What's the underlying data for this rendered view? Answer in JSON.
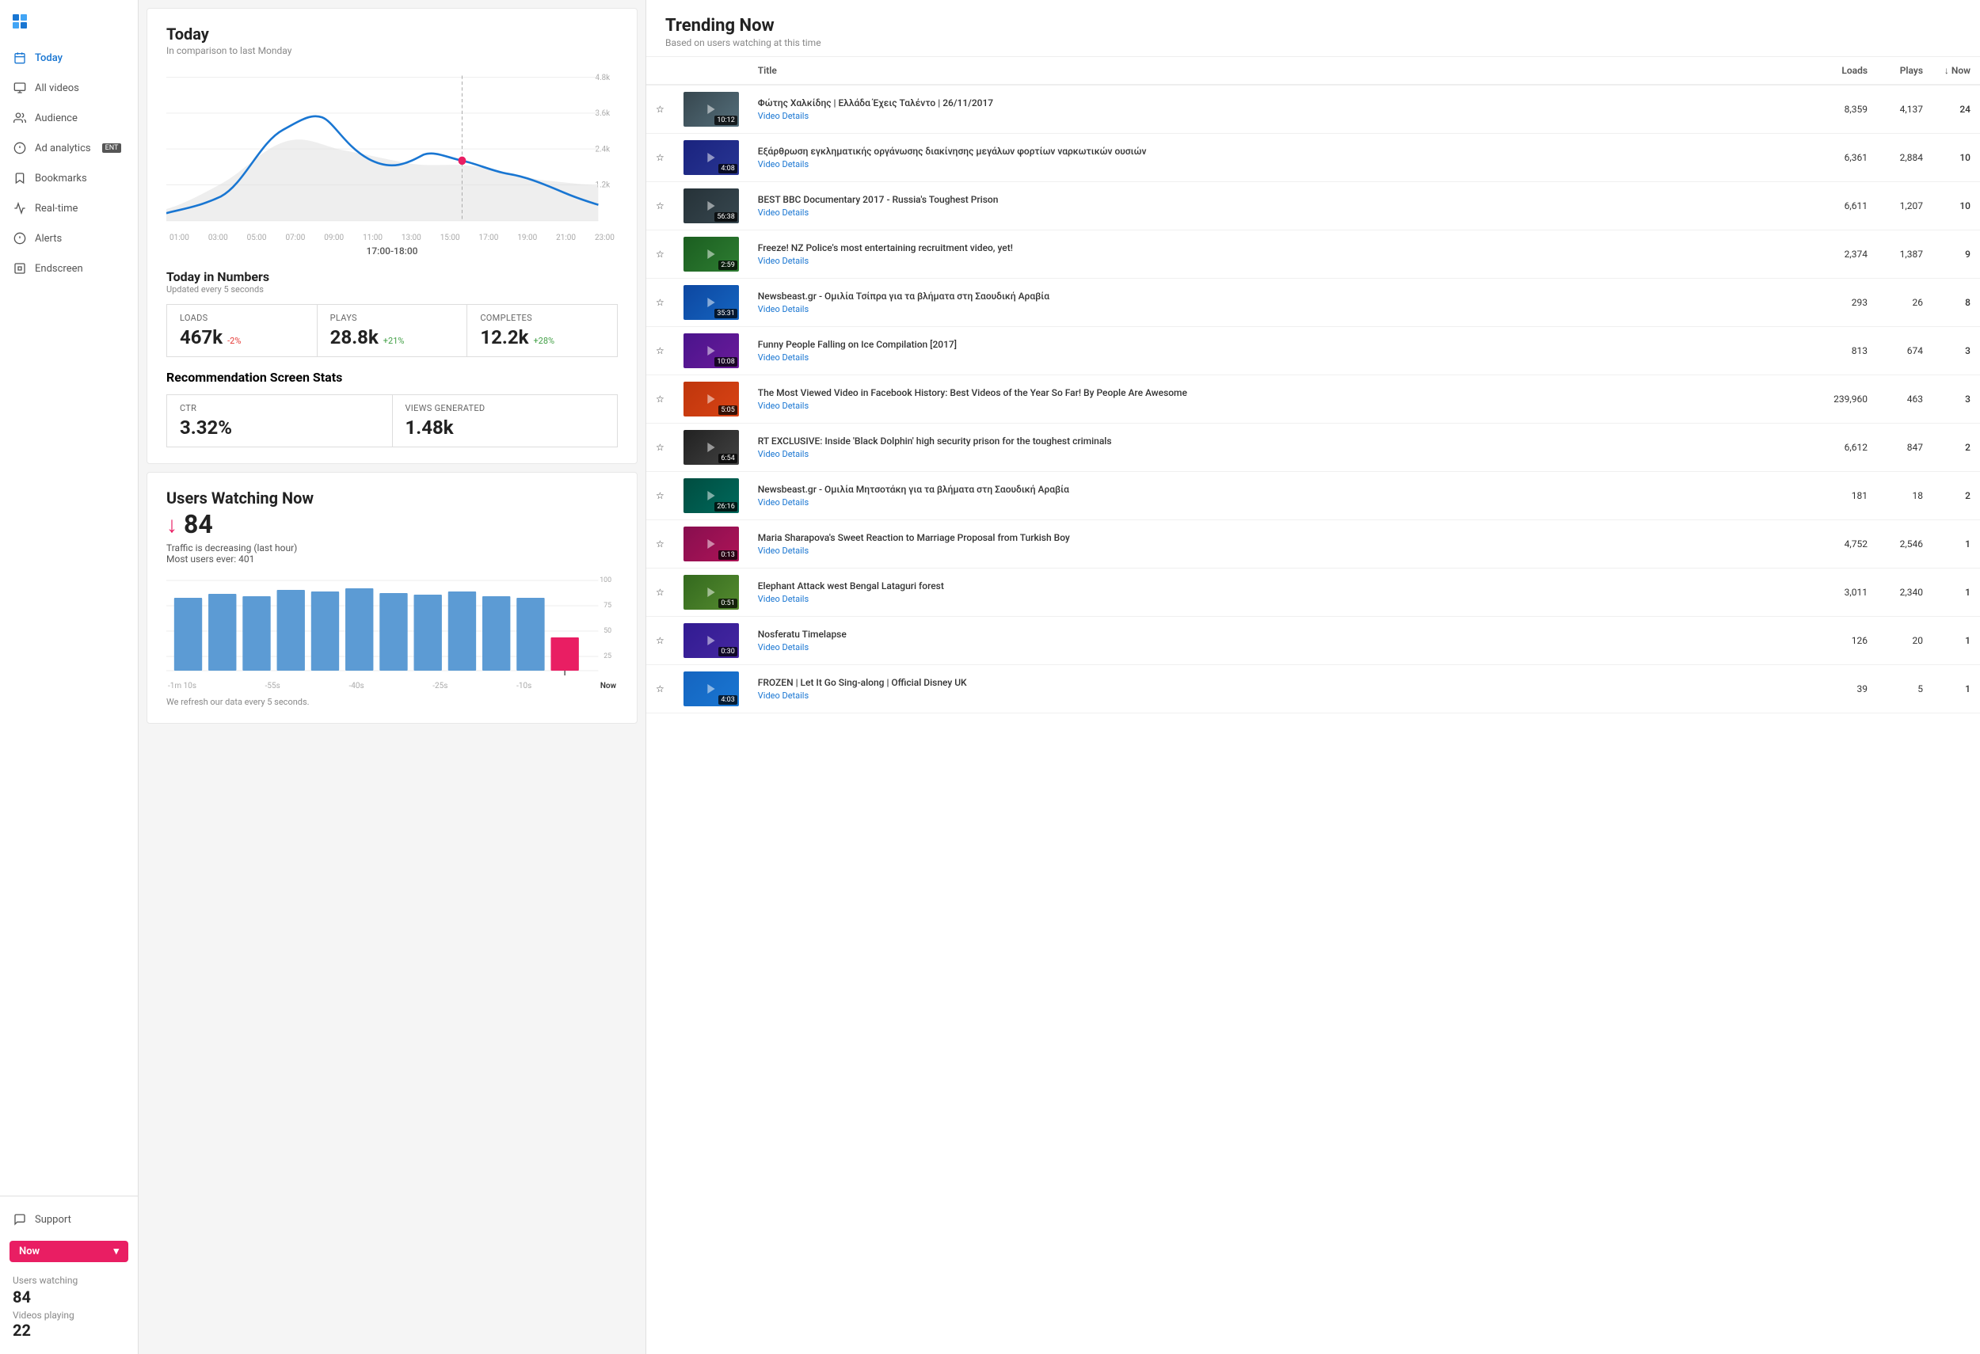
{
  "sidebar": {
    "nav_items": [
      {
        "id": "today",
        "label": "Today",
        "active": true
      },
      {
        "id": "all-videos",
        "label": "All videos",
        "active": false
      },
      {
        "id": "audience",
        "label": "Audience",
        "active": false
      },
      {
        "id": "ad-analytics",
        "label": "Ad analytics",
        "badge": "ENT",
        "active": false
      },
      {
        "id": "bookmarks",
        "label": "Bookmarks",
        "active": false
      },
      {
        "id": "real-time",
        "label": "Real-time",
        "active": false
      },
      {
        "id": "alerts",
        "label": "Alerts",
        "active": false
      },
      {
        "id": "endscreen",
        "label": "Endscreen",
        "active": false
      }
    ],
    "bottom": {
      "support_label": "Support",
      "now_button": "Now",
      "users_watching_label": "Users watching",
      "users_watching_value": "84",
      "videos_playing_label": "Videos playing",
      "videos_playing_value": "22"
    }
  },
  "today_panel": {
    "title": "Today",
    "subtitle": "In comparison to last Monday",
    "chart": {
      "y_labels": [
        "4.8k",
        "3.6k",
        "2.4k",
        "1.2k"
      ],
      "x_labels": [
        "01:00",
        "03:00",
        "05:00",
        "07:00",
        "09:00",
        "11:00",
        "13:00",
        "15:00",
        "17:00",
        "19:00",
        "21:00",
        "23:00"
      ],
      "time_label": "17:00-18:00"
    },
    "numbers": {
      "title": "Today in Numbers",
      "subtitle": "Updated every 5 seconds",
      "loads": {
        "label": "Loads",
        "value": "467k",
        "change": "-2%",
        "change_type": "neg"
      },
      "plays": {
        "label": "Plays",
        "value": "28.8k",
        "change": "+21%",
        "change_type": "pos"
      },
      "completes": {
        "label": "Completes",
        "value": "12.2k",
        "change": "+28%",
        "change_type": "pos"
      }
    },
    "recommendation": {
      "title": "Recommendation Screen Stats",
      "ctr": {
        "label": "CTR",
        "value": "3.32%"
      },
      "views_generated": {
        "label": "Views Generated",
        "value": "1.48k"
      }
    }
  },
  "watching_now_panel": {
    "title": "Users Watching Now",
    "count": "84",
    "traffic_note": "Traffic is decreasing (last hour)",
    "max_note": "Most users ever: 401",
    "bar_labels": [
      "-1m 10s",
      "-55s",
      "-40s",
      "-25s",
      "-10s",
      "Now"
    ],
    "y_labels": [
      "100",
      "75",
      "50",
      "25"
    ],
    "refresh_note": "We refresh our data every 5 seconds."
  },
  "trending": {
    "title": "Trending Now",
    "subtitle": "Based on users watching at this time",
    "col_title": "Title",
    "col_loads": "Loads",
    "col_plays": "Plays",
    "col_now": "↓ Now",
    "videos": [
      {
        "id": 1,
        "duration": "10:12",
        "title": "Φώτης Χαλκίδης | Ελλάδα Έχεις Ταλέντο | 26/11/2017",
        "details_link": "Video Details",
        "loads": "8,359",
        "plays": "4,137",
        "now": "24",
        "thumb_class": "t1"
      },
      {
        "id": 2,
        "duration": "4:08",
        "title": "Εξάρθρωση εγκληματικής οργάνωσης διακίνησης μεγάλων φορτίων ναρκωτικών ουσιών",
        "details_link": "Video Details",
        "loads": "6,361",
        "plays": "2,884",
        "now": "10",
        "thumb_class": "t2"
      },
      {
        "id": 3,
        "duration": "56:38",
        "title": "BEST BBC Documentary 2017 - Russia's Toughest Prison",
        "details_link": "Video Details",
        "loads": "6,611",
        "plays": "1,207",
        "now": "10",
        "thumb_class": "t3"
      },
      {
        "id": 4,
        "duration": "2:59",
        "title": "Freeze! NZ Police's most entertaining recruitment video, yet!",
        "details_link": "Video Details",
        "loads": "2,374",
        "plays": "1,387",
        "now": "9",
        "thumb_class": "t4"
      },
      {
        "id": 5,
        "duration": "35:31",
        "title": "Newsbeast.gr - Ομιλία Τσίπρα για τα βλήματα στη Σαουδική Αραβία",
        "details_link": "Video Details",
        "loads": "293",
        "plays": "26",
        "now": "8",
        "thumb_class": "t5"
      },
      {
        "id": 6,
        "duration": "10:08",
        "title": "Funny People Falling on Ice Compilation [2017]",
        "details_link": "Video Details",
        "loads": "813",
        "plays": "674",
        "now": "3",
        "thumb_class": "t6"
      },
      {
        "id": 7,
        "duration": "5:05",
        "title": "The Most Viewed Video in Facebook History: Best Videos of the Year So Far! By People Are Awesome",
        "details_link": "Video Details",
        "loads": "239,960",
        "plays": "463",
        "now": "3",
        "thumb_class": "t7"
      },
      {
        "id": 8,
        "duration": "6:54",
        "title": "RT EXCLUSIVE: Inside 'Black Dolphin' high security prison for the toughest criminals",
        "details_link": "Video Details",
        "loads": "6,612",
        "plays": "847",
        "now": "2",
        "thumb_class": "t8"
      },
      {
        "id": 9,
        "duration": "26:16",
        "title": "Newsbeast.gr - Ομιλία Μητσοτάκη για τα βλήματα στη Σαουδική Αραβία",
        "details_link": "Video Details",
        "loads": "181",
        "plays": "18",
        "now": "2",
        "thumb_class": "t9"
      },
      {
        "id": 10,
        "duration": "0:13",
        "title": "Maria Sharapova's Sweet Reaction to Marriage Proposal from Turkish Boy",
        "details_link": "Video Details",
        "loads": "4,752",
        "plays": "2,546",
        "now": "1",
        "thumb_class": "t10"
      },
      {
        "id": 11,
        "duration": "0:51",
        "title": "Elephant Attack west Bengal Lataguri forest",
        "details_link": "Video Details",
        "loads": "3,011",
        "plays": "2,340",
        "now": "1",
        "thumb_class": "t11"
      },
      {
        "id": 12,
        "duration": "0:30",
        "title": "Nosferatu Timelapse",
        "details_link": "Video Details",
        "loads": "126",
        "plays": "20",
        "now": "1",
        "thumb_class": "t12"
      },
      {
        "id": 13,
        "duration": "4:03",
        "title": "FROZEN | Let It Go Sing-along | Official Disney UK",
        "details_link": "Video Details",
        "loads": "39",
        "plays": "5",
        "now": "1",
        "thumb_class": "t13"
      }
    ]
  }
}
